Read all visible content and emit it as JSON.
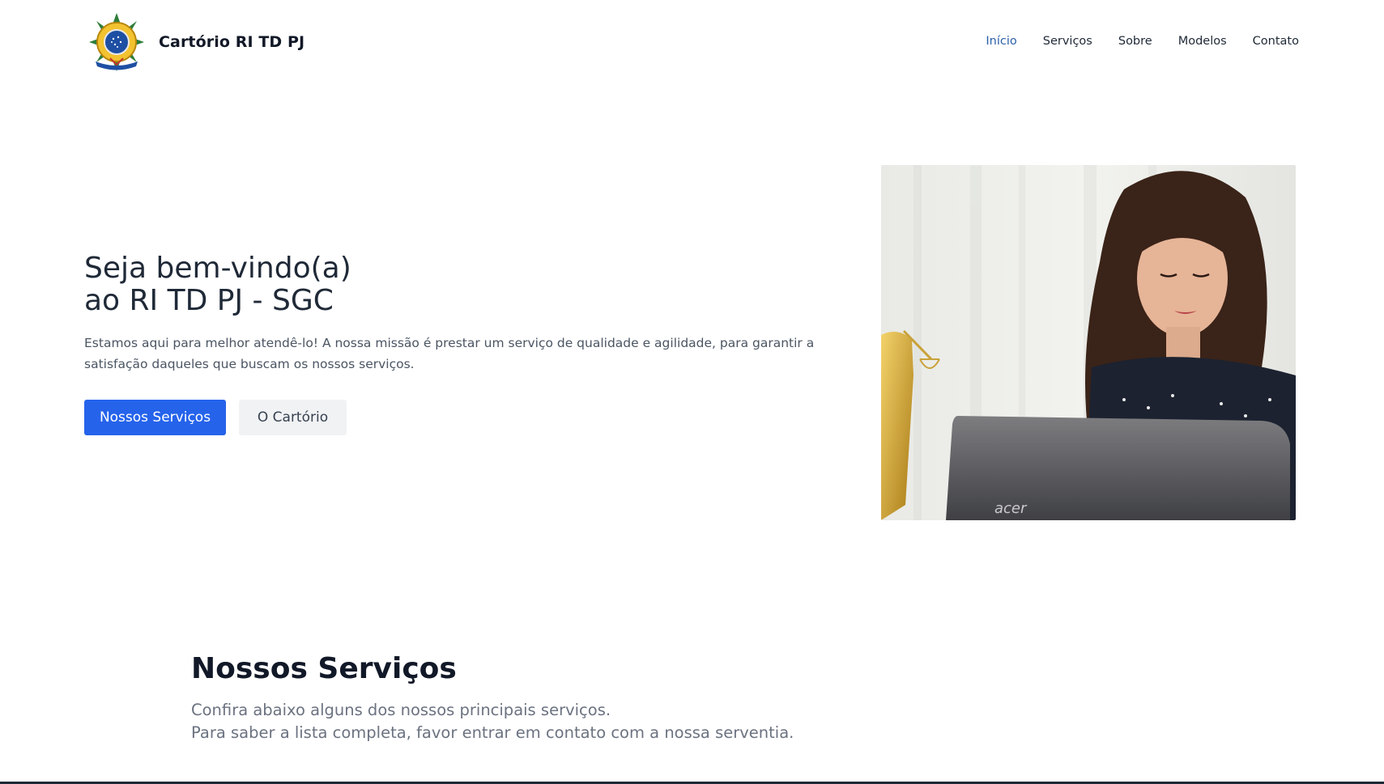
{
  "header": {
    "brand_name": "Cartório RI TD PJ",
    "logo_icon": "coat-of-arms-icon",
    "nav": [
      {
        "label": "Início",
        "active": true
      },
      {
        "label": "Serviços",
        "active": false
      },
      {
        "label": "Sobre",
        "active": false
      },
      {
        "label": "Modelos",
        "active": false
      },
      {
        "label": "Contato",
        "active": false
      }
    ]
  },
  "hero": {
    "title_line1": "Seja bem-vindo(a)",
    "title_line2": "ao RI TD PJ - SGC",
    "text": "Estamos aqui para melhor atendê-lo! A nossa missão é prestar um serviço de qualidade e agilidade, para garantir a satisfação daqueles que buscam os nossos serviços.",
    "primary_button": "Nossos Serviços",
    "secondary_button": "O Cartório",
    "laptop_brand": "acer"
  },
  "services": {
    "title": "Nossos Serviços",
    "subtitle_line1": "Confira abaixo alguns dos nossos principais serviços.",
    "subtitle_line2": "Para saber a lista completa, favor entrar em contato com a nossa serventia."
  },
  "colors": {
    "accent": "#2563eb",
    "nav_active": "#2b5fa8"
  }
}
